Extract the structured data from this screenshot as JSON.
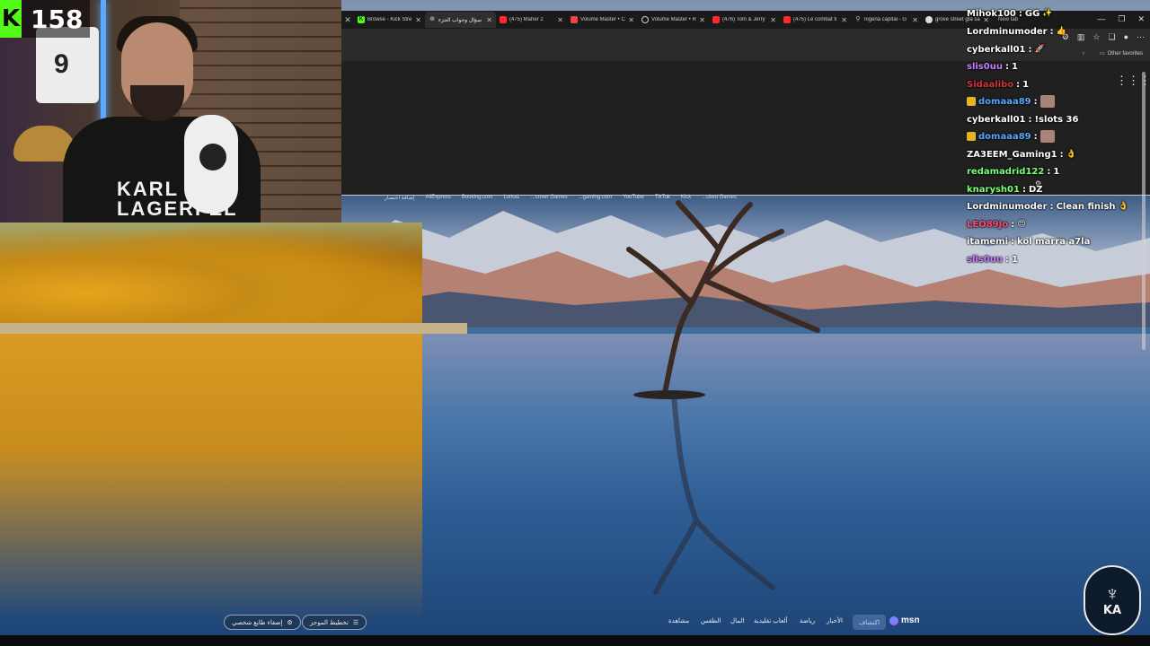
{
  "stream": {
    "viewer_count": "158",
    "webcam_shirt_text": [
      "KARL",
      "LAGERFEL"
    ],
    "jersey_number": "9"
  },
  "browser": {
    "tabs": [
      {
        "title": "Browse - Kick Stre",
        "favicon": "kick-icon",
        "color": "#53fc18"
      },
      {
        "title": "سؤال وجواب الجزء",
        "favicon": "globe-icon",
        "color": "#cfcfcf",
        "active": true
      },
      {
        "title": "(475) Maher 2",
        "favicon": "youtube-icon",
        "color": "#ff2a2a"
      },
      {
        "title": "Volume Master • C",
        "favicon": "volume-master-icon",
        "color": "#e44"
      },
      {
        "title": "Volume Master • R",
        "favicon": "circle-icon",
        "color": "#cfcfcf"
      },
      {
        "title": "(476) Tom & Jerry",
        "favicon": "youtube-icon",
        "color": "#ff2a2a"
      },
      {
        "title": "(475) Le combat fi",
        "favicon": "youtube-icon",
        "color": "#ff2a2a"
      },
      {
        "title": "nigeria capital - G",
        "favicon": "search-icon",
        "color": "#bbbbbb"
      },
      {
        "title": "grove street gta sa",
        "favicon": "chrome-icon",
        "color": "#dddddd"
      }
    ],
    "new_tab_label": "New tab",
    "other_favorites": "Other favorites",
    "shortcuts": [
      "إضافة اختصار",
      "AliExpress",
      "Booking.com",
      "LorkaL",
      "...cover Games",
      "...gaming.com",
      "YouTube",
      "TikTok",
      "Kick",
      "...cked Games"
    ]
  },
  "chat": [
    {
      "user": "Mihok100",
      "color": "#ffffff",
      "msg": "GG",
      "emote": "✨"
    },
    {
      "user": "Lordminumoder",
      "color": "#ffffff",
      "msg": "",
      "emote": "👍"
    },
    {
      "user": "cyberkall01",
      "color": "#ffffff",
      "msg": "",
      "emote": "🚀"
    },
    {
      "user": "slis0uu",
      "color": "#c77dff",
      "msg": "1"
    },
    {
      "user": "Sidaalibo",
      "color": "#d1313d",
      "msg": "1"
    },
    {
      "user": "domaaa89",
      "color": "#58a6ff",
      "msg": "",
      "badge": true,
      "emote_img": true
    },
    {
      "user": "cyberkall01",
      "color": "#ffffff",
      "msg": "!slots 36"
    },
    {
      "user": "domaaa89",
      "color": "#58a6ff",
      "msg": "",
      "badge": true,
      "emote_img": true
    },
    {
      "user": "ZA3EEM_Gaming1",
      "color": "#ffffff",
      "msg": "",
      "emote": "👌"
    },
    {
      "user": "redamadrid122",
      "color": "#7cff79",
      "msg": "1"
    },
    {
      "user": "knarysh01",
      "color": "#7cff79",
      "msg": "DZ"
    },
    {
      "user": "Lordminumoder",
      "color": "#ffffff",
      "msg": "Clean finish",
      "emote": "👌"
    },
    {
      "user": "LEO89Jo",
      "color": "#ff4b7a",
      "msg": "",
      "emote": "😍"
    },
    {
      "user": "itamemi",
      "color": "#ffffff",
      "msg": "kol marra a7la"
    },
    {
      "user": "slis0uu",
      "color": "#c77dff",
      "msg": "1"
    }
  ],
  "msn": {
    "logo": "msn",
    "nav": [
      "اكتشاف",
      "الأخبار",
      "رياضة",
      "ألعاب تقليدية",
      "المال",
      "الطقس",
      "مشاهدة"
    ],
    "active_index": 0,
    "buttons": {
      "layout": "تخطيط الموجز",
      "personalize": "إضفاء طابع شخصي"
    }
  },
  "channel_logo": {
    "mark": "KA"
  }
}
